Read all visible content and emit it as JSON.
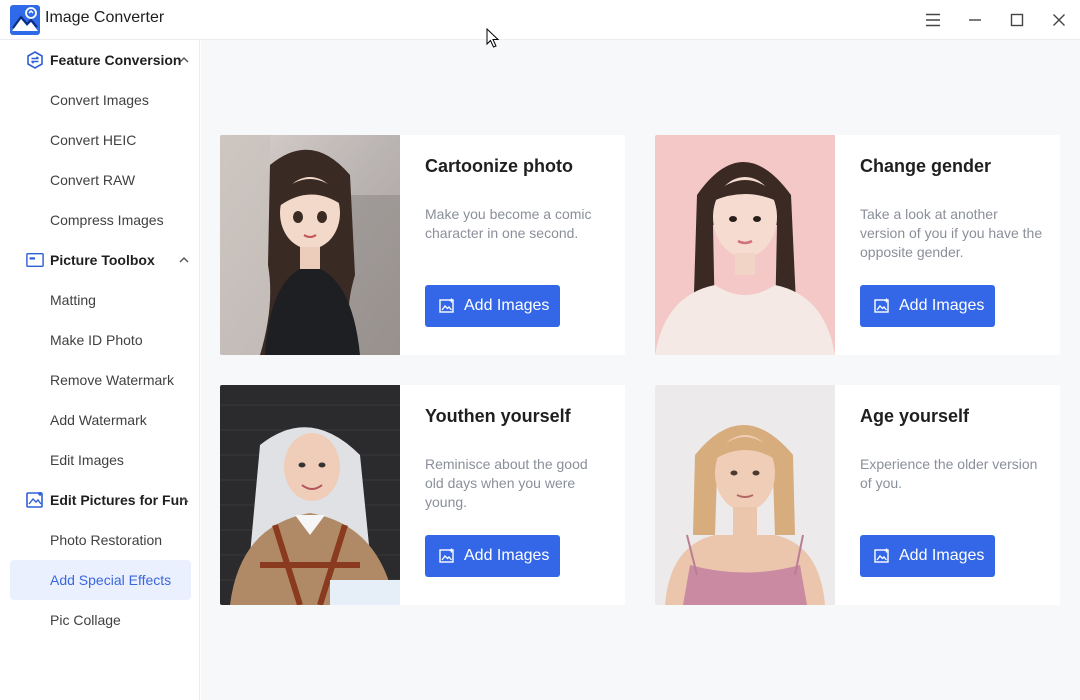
{
  "app": {
    "title": "Image Converter"
  },
  "window_controls": [
    {
      "name": "menu-icon"
    },
    {
      "name": "minimize-icon"
    },
    {
      "name": "maximize-icon"
    },
    {
      "name": "close-icon"
    }
  ],
  "sidebar": {
    "sections": [
      {
        "label": "Feature Conversion",
        "icon": "conversion-icon",
        "items": [
          "Convert Images",
          "Convert HEIC",
          "Convert RAW",
          "Compress Images"
        ]
      },
      {
        "label": "Picture Toolbox",
        "icon": "toolbox-icon",
        "items": [
          "Matting",
          "Make ID Photo",
          "Remove Watermark",
          "Add Watermark",
          "Edit Images"
        ]
      },
      {
        "label": "Edit Pictures for Fun",
        "icon": "fun-picture-icon",
        "items": [
          "Photo Restoration",
          "Add Special Effects",
          "Pic Collage"
        ]
      }
    ],
    "active_item": "Add Special Effects"
  },
  "cards": [
    {
      "title": "Cartoonize photo",
      "description": "Make you become a comic character in one second.",
      "button": "Add Images"
    },
    {
      "title": "Change gender",
      "description": "Take a look at another version of you if you have the opposite gender.",
      "button": "Add Images"
    },
    {
      "title": "Youthen yourself",
      "description": "Reminisce about the good old days when you were young.",
      "button": "Add Images"
    },
    {
      "title": "Age yourself",
      "description": "Experience the older version of you.",
      "button": "Add Images"
    }
  ],
  "colors": {
    "accent": "#3367e8",
    "active_bg": "#eaf0fd",
    "active_text": "#3a67e0",
    "main_bg": "#f7f8fa"
  }
}
